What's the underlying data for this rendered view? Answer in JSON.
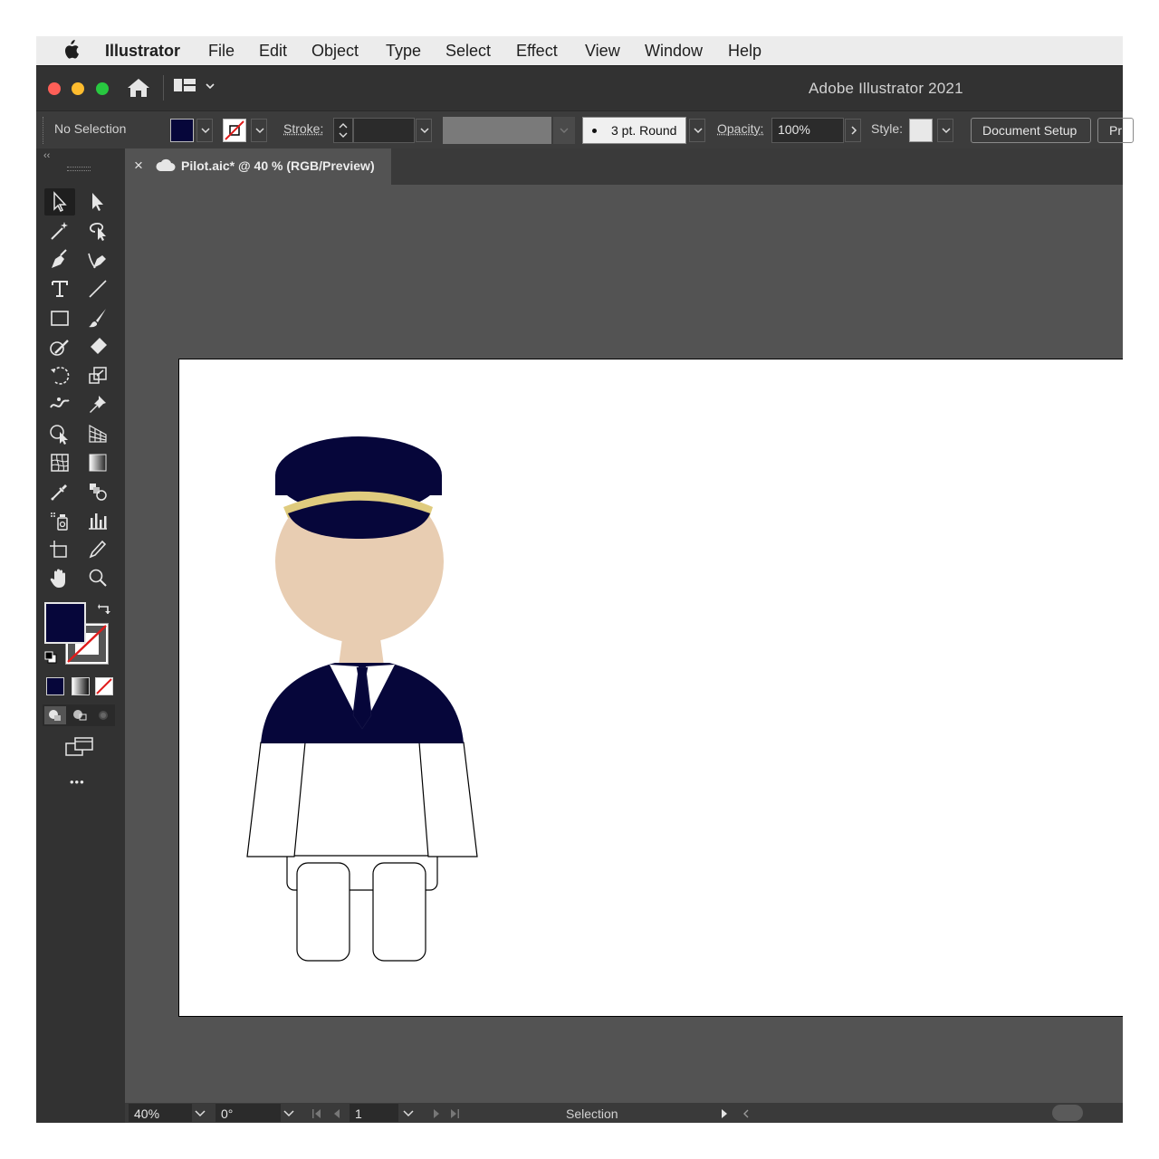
{
  "menubar": {
    "app_name": "Illustrator",
    "items": [
      "File",
      "Edit",
      "Object",
      "Type",
      "Select",
      "Effect",
      "View",
      "Window",
      "Help"
    ]
  },
  "titlebar": {
    "title": "Adobe Illustrator 2021"
  },
  "controlbar": {
    "selection_label": "No Selection",
    "stroke_label": "Stroke:",
    "brush_value": "3 pt. Round",
    "opacity_label": "Opacity:",
    "opacity_value": "100%",
    "style_label": "Style:",
    "document_setup_label": "Document Setup",
    "preferences_label": "Pr"
  },
  "document_tab": {
    "close_glyph": "×",
    "title": "Pilot.aic* @ 40 % (RGB/Preview)"
  },
  "tools": {
    "more_glyph": "•••"
  },
  "statusbar": {
    "zoom": "40%",
    "rotation": "0°",
    "artboard_number": "1",
    "tool_name": "Selection"
  },
  "colors": {
    "fill": "#06063a",
    "skin": "#e8cdb2",
    "cap_band": "#dfcb7e",
    "canvas_bg": "#535353",
    "panel_bg": "#323232"
  }
}
